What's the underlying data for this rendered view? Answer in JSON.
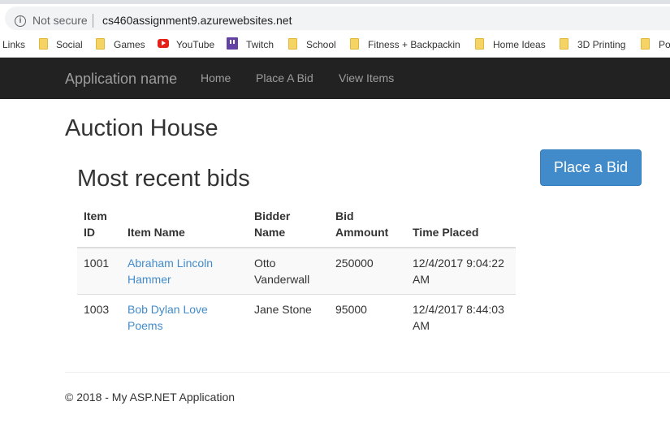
{
  "browser": {
    "security_label": "Not secure",
    "url": "cs460assignment9.azurewebsites.net",
    "bookmarks": [
      {
        "label": "Links",
        "icon": "none"
      },
      {
        "label": "Social",
        "icon": "folder-icon"
      },
      {
        "label": "Games",
        "icon": "folder-icon"
      },
      {
        "label": "YouTube",
        "icon": "youtube-icon"
      },
      {
        "label": "Twitch",
        "icon": "twitch-icon"
      },
      {
        "label": "School",
        "icon": "folder-icon"
      },
      {
        "label": "Fitness + Backpacking",
        "icon": "folder-icon"
      },
      {
        "label": "Home Ideas",
        "icon": "folder-icon"
      },
      {
        "label": "3D Printing",
        "icon": "folder-icon"
      },
      {
        "label": "Po",
        "icon": "folder-icon"
      }
    ]
  },
  "navbar": {
    "brand": "Application name",
    "links": [
      "Home",
      "Place A Bid",
      "View Items"
    ]
  },
  "main": {
    "title": "Auction House",
    "subtitle": "Most recent bids",
    "place_bid_button": "Place a Bid",
    "table": {
      "headers": [
        [
          "Item",
          "ID"
        ],
        [
          "Item Name"
        ],
        [
          "Bidder",
          "Name"
        ],
        [
          "Bid",
          "Ammount"
        ],
        [
          "Time Placed"
        ]
      ],
      "rows": [
        {
          "item_id": "1001",
          "item_name": [
            "Abraham Lincoln",
            "Hammer"
          ],
          "bidder": [
            "Otto",
            "Vanderwall"
          ],
          "amount": "250000",
          "time": [
            "12/4/2017 9:04:22",
            "AM"
          ]
        },
        {
          "item_id": "1003",
          "item_name": [
            "Bob Dylan Love",
            "Poems"
          ],
          "bidder": [
            "Jane Stone"
          ],
          "amount": "95000",
          "time": [
            "12/4/2017 8:44:03",
            "AM"
          ]
        }
      ]
    }
  },
  "footer": {
    "text": "© 2018 - My ASP.NET Application"
  },
  "colors": {
    "navbar_bg": "#222222",
    "link": "#428bca",
    "button_bg": "#428bca"
  }
}
